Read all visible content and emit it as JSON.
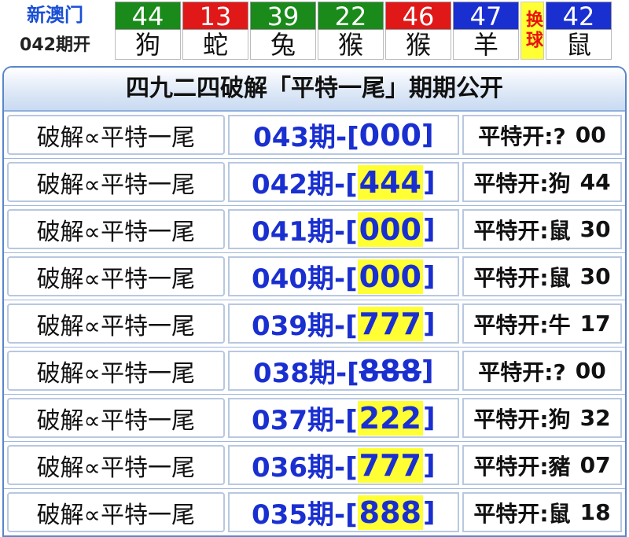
{
  "brand": {
    "name": "新澳门",
    "issue": "042期开"
  },
  "draw": [
    {
      "number": "44",
      "zodiac": "狗",
      "color": "#1a8a1a"
    },
    {
      "number": "13",
      "zodiac": "蛇",
      "color": "#e01818"
    },
    {
      "number": "39",
      "zodiac": "兔",
      "color": "#1a8a1a"
    },
    {
      "number": "22",
      "zodiac": "猴",
      "color": "#1a8a1a"
    },
    {
      "number": "46",
      "zodiac": "猴",
      "color": "#e01818"
    },
    {
      "number": "47",
      "zodiac": "羊",
      "color": "#1a2fd0"
    }
  ],
  "special": {
    "number": "42",
    "zodiac": "鼠",
    "color": "#1a2fd0"
  },
  "swap_label": "换球",
  "panel_title": "四九二四破解「平特一尾」期期公开",
  "rows": [
    {
      "label": "破解∝平特一尾",
      "period": "043期-[",
      "code": "000",
      "close": "]",
      "highlight": false,
      "strike": false,
      "result": "平特开:?",
      "result_num": "00"
    },
    {
      "label": "破解∝平特一尾",
      "period": "042期-[",
      "code": "444",
      "close": "]",
      "highlight": true,
      "strike": false,
      "result": "平特开:狗",
      "result_num": "44"
    },
    {
      "label": "破解∝平特一尾",
      "period": "041期-[",
      "code": "000",
      "close": "]",
      "highlight": true,
      "strike": false,
      "result": "平特开:鼠",
      "result_num": "30"
    },
    {
      "label": "破解∝平特一尾",
      "period": "040期-[",
      "code": "000",
      "close": "]",
      "highlight": true,
      "strike": false,
      "result": "平特开:鼠",
      "result_num": "30"
    },
    {
      "label": "破解∝平特一尾",
      "period": "039期-[",
      "code": "777",
      "close": "]",
      "highlight": true,
      "strike": false,
      "result": "平特开:牛",
      "result_num": "17"
    },
    {
      "label": "破解∝平特一尾",
      "period": "038期-[",
      "code": "888",
      "close": "]",
      "highlight": false,
      "strike": true,
      "result": "平特开:?",
      "result_num": "00"
    },
    {
      "label": "破解∝平特一尾",
      "period": "037期-[",
      "code": "222",
      "close": "]",
      "highlight": true,
      "strike": false,
      "result": "平特开:狗",
      "result_num": "32"
    },
    {
      "label": "破解∝平特一尾",
      "period": "036期-[",
      "code": "777",
      "close": "]",
      "highlight": true,
      "strike": false,
      "result": "平特开:豬",
      "result_num": "07"
    },
    {
      "label": "破解∝平特一尾",
      "period": "035期-[",
      "code": "888",
      "close": "]",
      "highlight": true,
      "strike": false,
      "result": "平特开:鼠",
      "result_num": "18"
    }
  ]
}
